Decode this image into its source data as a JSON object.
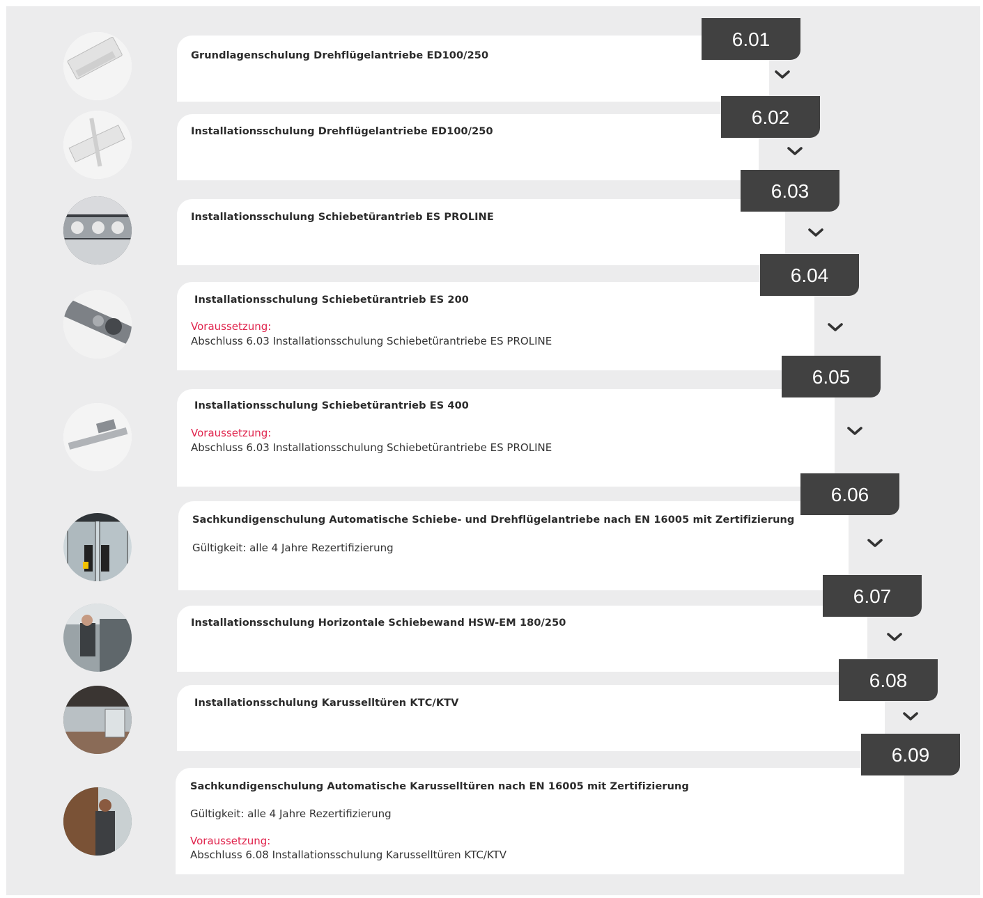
{
  "courses": [
    {
      "number": "6.01",
      "title": "Grundlagenschulung Drehflügelantriebe ED100/250",
      "image_icon": "swing-door-operator-photo",
      "lines": []
    },
    {
      "number": "6.02",
      "title": "Installationsschulung Drehflügelantriebe ED100/250",
      "image_icon": "swing-door-arm-photo",
      "lines": []
    },
    {
      "number": "6.03",
      "title": "Installationsschulung Schiebetürantrieb ES PROLINE",
      "image_icon": "sliding-door-mechanism-photo",
      "lines": []
    },
    {
      "number": "6.04",
      "title": "Installationsschulung Schiebetürantrieb ES 200",
      "image_icon": "sliding-drive-rail-photo",
      "lines": [
        {
          "text": "Voraussetzung:",
          "style": "red"
        },
        {
          "text": "Abschluss 6.03 Installationsschulung Schiebetürantriebe ES PROLINE",
          "style": "normal"
        }
      ]
    },
    {
      "number": "6.05",
      "title": "Installationsschulung Schiebetürantrieb ES 400",
      "image_icon": "sliding-drive-unit-photo",
      "lines": [
        {
          "text": "Voraussetzung:",
          "style": "red"
        },
        {
          "text": "Abschluss 6.03 Installationsschulung Schiebetürantriebe ES PROLINE",
          "style": "normal"
        }
      ]
    },
    {
      "number": "6.06",
      "title": "Sachkundigenschulung Automatische Schiebe- und Drehflügelantriebe nach EN 16005 mit Zertifizierung",
      "image_icon": "automatic-door-entrance-photo",
      "lines": [
        {
          "text": "Gültigkeit: alle 4 Jahre Rezertifizierung",
          "style": "normal"
        }
      ]
    },
    {
      "number": "6.07",
      "title": "Installationsschulung Horizontale Schiebewand HSW-EM 180/250",
      "image_icon": "technician-installing-photo",
      "lines": []
    },
    {
      "number": "6.08",
      "title": "Installationsschulung Karusselltüren KTC/KTV",
      "image_icon": "revolving-door-lobby-photo",
      "lines": []
    },
    {
      "number": "6.09",
      "title": "Sachkundigenschulung Automatische Karusselltüren nach EN 16005 mit Zertifizierung",
      "image_icon": "technician-revolving-door-photo",
      "lines": [
        {
          "text": "Gültigkeit: alle 4 Jahre Rezertifizierung",
          "style": "normal"
        },
        {
          "text": "Voraussetzung:",
          "style": "red"
        },
        {
          "text": "Abschluss 6.08 Installationsschulung Karusselltüren KTC/KTV",
          "style": "normal"
        }
      ]
    }
  ],
  "colors": {
    "panel": "#ececed",
    "card": "#ffffff",
    "badge": "#414141",
    "accent_red": "#e0234c"
  }
}
